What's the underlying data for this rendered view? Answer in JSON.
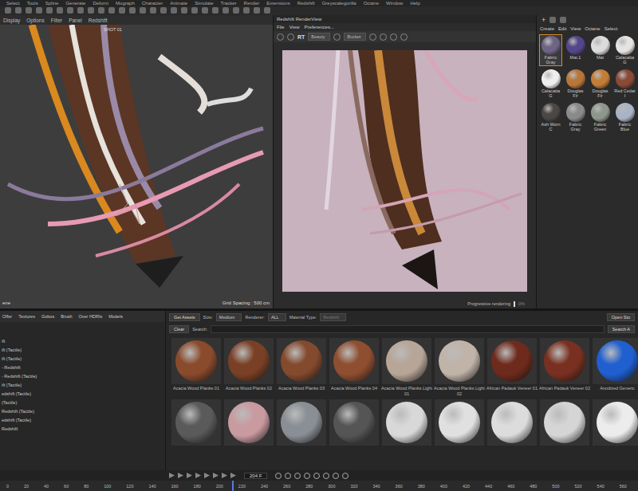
{
  "menu_bar": [
    "Select",
    "Tools",
    "Spline",
    "Generate",
    "Deform",
    "Mograph",
    "Character",
    "Animate",
    "Simulate",
    "Tracker",
    "Render",
    "Extensions",
    "Redshift",
    "Greyscalegorilla",
    "Octane",
    "Window",
    "Help"
  ],
  "viewport": {
    "menu": [
      "Display",
      "Options",
      "Filter",
      "Panel",
      "Redshift"
    ],
    "camera": "SHOT 01",
    "grid": "Grid Spacing : 500 cm",
    "corner": "ene"
  },
  "render_view": {
    "title": "Redshift RenderView",
    "menu": [
      "File",
      "View",
      "Preferences..."
    ],
    "rt": "RT",
    "aov": "Beauty",
    "mode": "Bucket",
    "status": "Progressive rendering",
    "percent": "0%"
  },
  "material_manager": {
    "menu": [
      "Create",
      "Edit",
      "View",
      "Octane",
      "Select"
    ],
    "materials": [
      {
        "name": "Fabric Gray",
        "color": "#6e6485",
        "selected": true
      },
      {
        "name": "Mat.1",
        "color": "#54468a",
        "selected": false
      },
      {
        "name": "Mat",
        "color": "#dcdcdc",
        "selected": false
      },
      {
        "name": "Calacatta G",
        "color": "#e6e4e2",
        "selected": false
      },
      {
        "name": "Calacatta G",
        "color": "#eeeeee",
        "selected": false
      },
      {
        "name": "Douglas Fir",
        "color": "#b8763a",
        "selected": false
      },
      {
        "name": "Douglas Fir",
        "color": "#c27d36",
        "selected": false
      },
      {
        "name": "Red Cedar I",
        "color": "#8a4a38",
        "selected": false
      },
      {
        "name": "Ash Worn C",
        "color": "#4a4744",
        "selected": false
      },
      {
        "name": "Fabric Gray",
        "color": "#8a8a8a",
        "selected": false
      },
      {
        "name": "Fabric Green",
        "color": "#8d978c",
        "selected": false
      },
      {
        "name": "Fabric Blue",
        "color": "#aab3c6",
        "selected": false
      }
    ]
  },
  "asset_browser": {
    "tabs": [
      "Offer",
      "Textures",
      "Gobos",
      "Brush",
      "Over HDRIs",
      "Models"
    ],
    "tree": [
      "ift",
      "ift (Tactile)",
      "ift (Tactile)",
      "- Redshift",
      "- Redshift (Tactile)",
      "ift (Tactile)",
      "edshift (Tactile)",
      "(Tactile)",
      "Redshift (Tactile)",
      "edshift (Tactile)",
      "Redshift"
    ],
    "get_assets": "Get Assets",
    "size_label": "Size:",
    "size": "Medium",
    "renderer_label": "Renderer:",
    "renderer": "ALL",
    "type_label": "Material Type:",
    "type": "Redshift",
    "open": "Open Sto",
    "clear": "Clear",
    "search_label": "Search:",
    "search_all": "Search A",
    "assets": [
      {
        "name": "Acacia Wood Planks 01",
        "color": "#8a4a2c"
      },
      {
        "name": "Acacia Wood Planks 02",
        "color": "#7a4026"
      },
      {
        "name": "Acacia Wood Planks 03",
        "color": "#844a2e"
      },
      {
        "name": "Acacia Wood Planks 04",
        "color": "#8e4e30"
      },
      {
        "name": "Acacia Wood Planks Light 01",
        "color": "#b7a597"
      },
      {
        "name": "Acacia Wood Planks Light 02",
        "color": "#c0b3a8"
      },
      {
        "name": "African Padauk Veneer 01",
        "color": "#6e2a1c"
      },
      {
        "name": "African Padauk Veneer 02",
        "color": "#7a3020"
      },
      {
        "name": "Anodized Generic",
        "color": "#1f5fd0"
      }
    ],
    "assets_row2": [
      {
        "color": "#5a5a5a"
      },
      {
        "color": "#c99aa0"
      },
      {
        "color": "#8a8f95"
      },
      {
        "color": "#555555"
      },
      {
        "color": "#d8d8d8"
      },
      {
        "color": "#e0e0e0"
      },
      {
        "color": "#dcdcdc"
      },
      {
        "color": "#d5d5d5"
      },
      {
        "color": "#ececec"
      }
    ]
  },
  "timeline": {
    "frame": "204 F",
    "playhead_level": 0.364,
    "ticks": [
      "0",
      "20",
      "40",
      "60",
      "80",
      "100",
      "120",
      "140",
      "160",
      "180",
      "200",
      "220",
      "240",
      "260",
      "280",
      "300",
      "320",
      "340",
      "360",
      "380",
      "400",
      "420",
      "440",
      "460",
      "480",
      "500",
      "520",
      "540",
      "560"
    ]
  }
}
